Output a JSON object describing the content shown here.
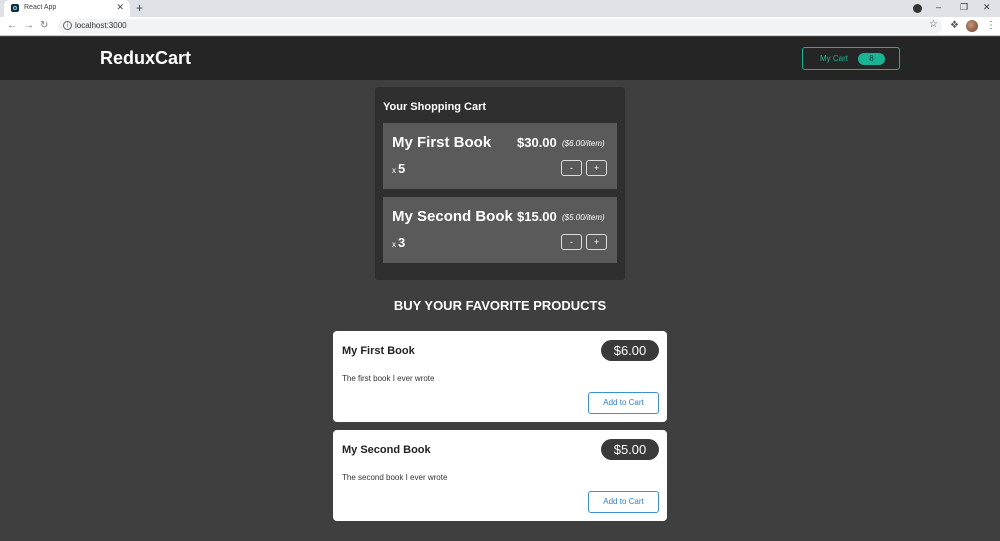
{
  "browser": {
    "tab_title": "React App",
    "tab_close": "✕",
    "new_tab": "+",
    "url": "localhost:3000",
    "win_minimize": "–",
    "win_restore": "❐",
    "win_close": "✕"
  },
  "header": {
    "brand": "ReduxCart",
    "cart_button_label": "My Cart",
    "cart_count": "8"
  },
  "cart": {
    "title": "Your Shopping Cart",
    "qty_prefix": "x",
    "decrement_label": "-",
    "increment_label": "+",
    "items": [
      {
        "name": "My First Book",
        "total": "$30.00",
        "per_item": "($6.00/item)",
        "quantity": "5"
      },
      {
        "name": "My Second Book",
        "total": "$15.00",
        "per_item": "($5.00/item)",
        "quantity": "3"
      }
    ]
  },
  "products": {
    "heading": "BUY YOUR FAVORITE PRODUCTS",
    "add_label": "Add to Cart",
    "items": [
      {
        "name": "My First Book",
        "price": "$6.00",
        "description": "The first book I ever wrote"
      },
      {
        "name": "My Second Book",
        "price": "$5.00",
        "description": "The second book I ever wrote"
      }
    ]
  },
  "colors": {
    "accent": "#1ab394",
    "background": "#3f3f3f",
    "header_bg": "#252525",
    "button_blue": "#2f7fc4"
  }
}
